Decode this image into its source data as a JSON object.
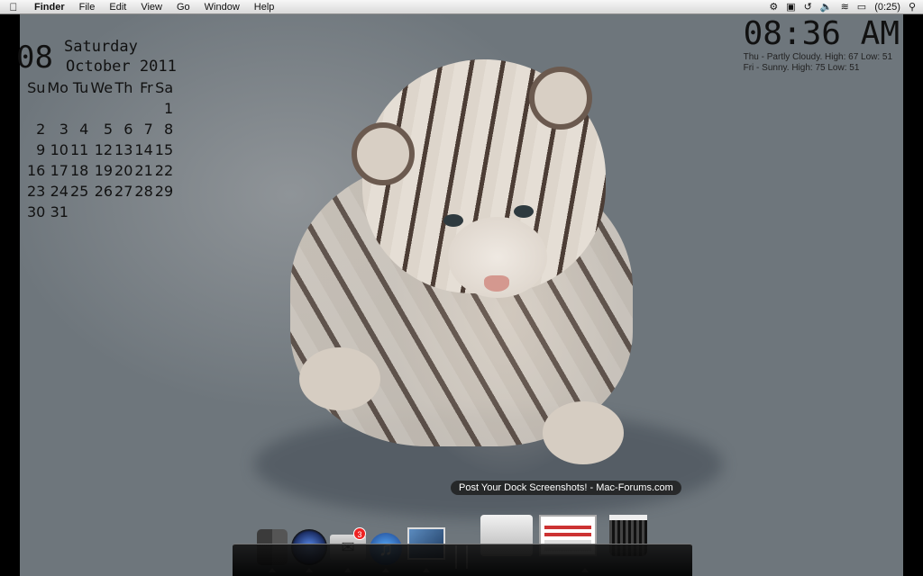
{
  "menubar": {
    "apple_icon": "apple-logo",
    "items": [
      "Finder",
      "File",
      "Edit",
      "View",
      "Go",
      "Window",
      "Help"
    ],
    "battery_text": "(0:25)"
  },
  "calendar": {
    "day_number": "08",
    "weekday": "Saturday",
    "month_year": "October 2011",
    "weekday_headers": [
      "Su",
      "Mo",
      "Tu",
      "We",
      "Th",
      "Fr",
      "Sa"
    ],
    "weeks": [
      [
        "",
        "",
        "",
        "",
        "",
        "",
        "1"
      ],
      [
        "2",
        "3",
        "4",
        "5",
        "6",
        "7",
        "8"
      ],
      [
        "9",
        "10",
        "11",
        "12",
        "13",
        "14",
        "15"
      ],
      [
        "16",
        "17",
        "18",
        "19",
        "20",
        "21",
        "22"
      ],
      [
        "23",
        "24",
        "25",
        "26",
        "27",
        "28",
        "29"
      ],
      [
        "30",
        "31",
        "",
        "",
        "",
        "",
        ""
      ]
    ]
  },
  "clock": {
    "time": "08:36 AM",
    "forecast": [
      "Thu - Partly Cloudy. High: 67 Low: 51",
      "Fri - Sunny. High: 75 Low: 51"
    ]
  },
  "dock": {
    "tooltip": "Post Your Dock Screenshots! - Mac-Forums.com",
    "mail_badge": "3",
    "icons": [
      "finder-icon",
      "camera-icon",
      "mail-icon",
      "itunes-icon",
      "iphoto-icon",
      "divider-icon",
      "folder-icon",
      "browser-icon",
      "trash-icon"
    ]
  },
  "colors": {
    "menubar_bg": "#e6e6e6",
    "badge": "#e22222"
  }
}
